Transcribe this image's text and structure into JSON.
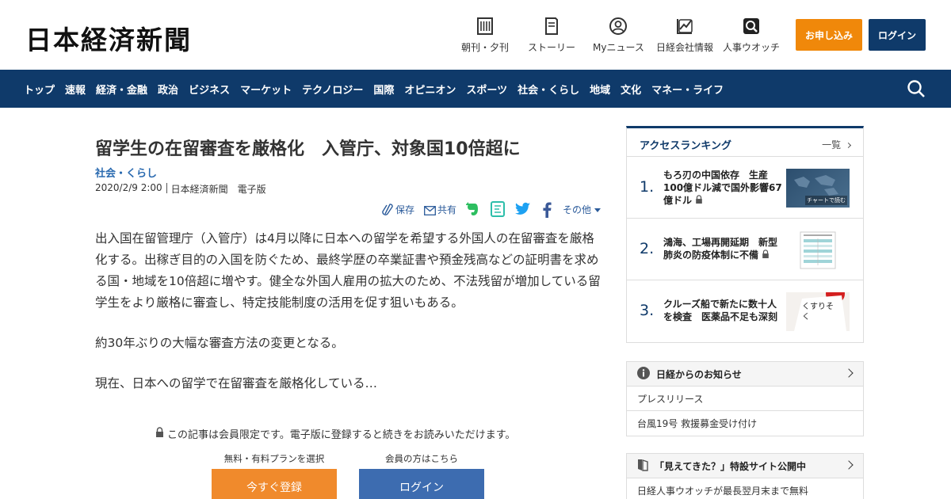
{
  "header": {
    "logo": "日本経済新聞",
    "nav": [
      {
        "label": "朝刊・夕刊",
        "icon": "newspaper-icon"
      },
      {
        "label": "ストーリー",
        "icon": "book-icon"
      },
      {
        "label": "Myニュース",
        "icon": "user-icon"
      },
      {
        "label": "日経会社情報",
        "icon": "chart-icon"
      },
      {
        "label": "人事ウオッチ",
        "icon": "search-person-icon"
      }
    ],
    "apply_label": "お申し込み",
    "login_label": "ログイン"
  },
  "navbar": {
    "items": [
      "トップ",
      "速報",
      "経済・金融",
      "政治",
      "ビジネス",
      "マーケット",
      "テクノロジー",
      "国際",
      "オピニオン",
      "スポーツ",
      "社会・くらし",
      "地域",
      "文化",
      "マネー・ライフ"
    ]
  },
  "article": {
    "title": "留学生の在留審査を厳格化　入管庁、対象国10倍超に",
    "category": "社会・くらし",
    "date": "2020/2/9 2:00",
    "source": "日本経済新聞　電子版",
    "share": {
      "save": "保存",
      "share": "共有",
      "other": "その他"
    },
    "paragraphs": [
      "出入国在留管理庁（入管庁）は4月以降に日本への留学を希望する外国人の在留審査を厳格化する。出稼ぎ目的の入国を防ぐため、最終学歴の卒業証書や預金残高などの証明書を求める国・地域を10倍超に増やす。健全な外国人雇用の拡大のため、不法残留が増加している留学生をより厳格に審査し、特定技能制度の活用を促す狙いもある。",
      "約30年ぶりの大幅な審査方法の変更となる。",
      "現在、日本への留学で在留審査を厳格化している…"
    ],
    "paywall_note": "この記事は会員限定です。電子版に登録すると続きをお読みいただけます。",
    "plan_label": "無料・有料プランを選択",
    "member_label": "会員の方はこちら",
    "register_label": "今すぐ登録",
    "login_label": "ログイン"
  },
  "ranking": {
    "heading": "アクセスランキング",
    "more": "一覧",
    "items": [
      {
        "num": "1.",
        "title": "もろ刃の中国依存　生産100億ドル減で国外影響67億ドル",
        "thumb_text": "チャートで読む"
      },
      {
        "num": "2.",
        "title": "鴻海、工場再開延期　新型肺炎の防疫体制に不備"
      },
      {
        "num": "3.",
        "title": "クルーズ船で新たに数十人を検査　医薬品不足も深刻",
        "thumb_text": "くすりそく"
      }
    ]
  },
  "notices": {
    "heading": "日経からのお知らせ",
    "items": [
      "プレスリリース",
      "台風19号 救援募金受け付け"
    ]
  },
  "promo": {
    "heading": "「見えてきた？」特設サイト公開中",
    "items": [
      "日経人事ウオッチが最長翌月末まで無料"
    ]
  },
  "colors": {
    "brand_navy": "#0f3a6a",
    "apply_orange": "#f0880a",
    "register_orange": "#f08a2c",
    "login_blue": "#3d6cb0",
    "category_blue": "#2a6ab0"
  }
}
